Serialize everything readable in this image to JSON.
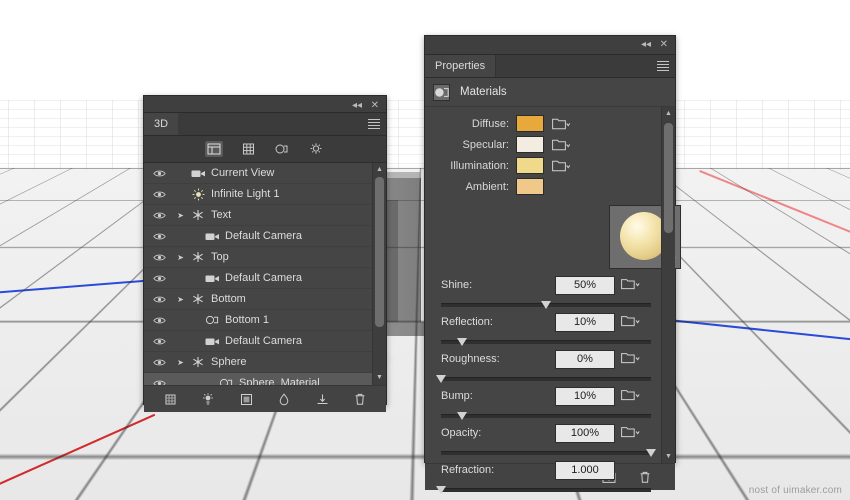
{
  "viewport": {
    "watermark": "nost of uimaker.com"
  },
  "panel_3d": {
    "tab_label": "3D",
    "collapse_icon": "collapse-icon",
    "close_icon": "close-icon",
    "menu_icon": "panel-menu-icon",
    "filters": [
      {
        "name": "filter-scene",
        "icon": "scene-filter-icon",
        "active": true
      },
      {
        "name": "filter-mesh",
        "icon": "mesh-filter-icon",
        "active": false
      },
      {
        "name": "filter-material",
        "icon": "material-filter-icon",
        "active": false
      },
      {
        "name": "filter-light",
        "icon": "light-filter-icon",
        "active": false
      }
    ],
    "rows": [
      {
        "label": "Current View",
        "icon": "camera-icon",
        "indent": 0,
        "arrow": false,
        "selected": false
      },
      {
        "label": "Infinite Light 1",
        "icon": "light-icon",
        "indent": 0,
        "arrow": false,
        "selected": false
      },
      {
        "label": "Text",
        "icon": "mesh-icon",
        "indent": 0,
        "arrow": true,
        "selected": false
      },
      {
        "label": "Default Camera",
        "icon": "camera-icon",
        "indent": 1,
        "arrow": false,
        "selected": false
      },
      {
        "label": "Top",
        "icon": "mesh-icon",
        "indent": 0,
        "arrow": true,
        "selected": false
      },
      {
        "label": "Default Camera",
        "icon": "camera-icon",
        "indent": 1,
        "arrow": false,
        "selected": false
      },
      {
        "label": "Bottom",
        "icon": "mesh-icon",
        "indent": 0,
        "arrow": true,
        "selected": false
      },
      {
        "label": "Bottom 1",
        "icon": "material-icon",
        "indent": 1,
        "arrow": false,
        "selected": false
      },
      {
        "label": "Default Camera",
        "icon": "camera-icon",
        "indent": 1,
        "arrow": false,
        "selected": false
      },
      {
        "label": "Sphere",
        "icon": "mesh-icon",
        "indent": 0,
        "arrow": true,
        "selected": false
      },
      {
        "label": "Sphere_Material",
        "icon": "material-icon",
        "indent": 2,
        "arrow": false,
        "selected": true
      }
    ],
    "footer_buttons": [
      {
        "name": "new-mesh-button",
        "icon": "mesh-add-icon"
      },
      {
        "name": "new-light-button",
        "icon": "light-add-icon"
      },
      {
        "name": "render-button",
        "icon": "render-icon"
      },
      {
        "name": "paint-falloff-button",
        "icon": "paint-icon"
      },
      {
        "name": "ground-plane-button",
        "icon": "ground-icon"
      },
      {
        "name": "delete-button",
        "icon": "trash-icon"
      }
    ]
  },
  "properties": {
    "tab_label": "Properties",
    "collapse_icon": "collapse-icon",
    "close_icon": "close-icon",
    "menu_icon": "panel-menu-icon",
    "section_title": "Materials",
    "section_icon": "materials-icon",
    "swatches": [
      {
        "label": "Diffuse:",
        "color": "#e8a93c",
        "folder": "texture-menu-icon"
      },
      {
        "label": "Specular:",
        "color": "#f2ece1",
        "folder": "texture-menu-icon"
      },
      {
        "label": "Illumination:",
        "color": "#f0d98a",
        "folder": "texture-menu-icon"
      },
      {
        "label": "Ambient:",
        "color": "#efc88a",
        "folder": null
      }
    ],
    "preview": {
      "name": "material-preview",
      "caret": "preview-dropdown-caret"
    },
    "sliders": [
      {
        "label": "Shine:",
        "value": "50%",
        "fill": 0.5,
        "folder": true
      },
      {
        "label": "Reflection:",
        "value": "10%",
        "fill": 0.1,
        "folder": true
      },
      {
        "label": "Roughness:",
        "value": "0%",
        "fill": 0.0,
        "folder": true
      },
      {
        "label": "Bump:",
        "value": "10%",
        "fill": 0.1,
        "folder": true
      },
      {
        "label": "Opacity:",
        "value": "100%",
        "fill": 1.0,
        "folder": true
      },
      {
        "label": "Refraction:",
        "value": "1.000",
        "fill": 0.0,
        "folder": false
      }
    ],
    "footer_buttons": [
      {
        "name": "load-material-button",
        "icon": "load-icon"
      },
      {
        "name": "delete-material-button",
        "icon": "trash-icon"
      }
    ]
  }
}
